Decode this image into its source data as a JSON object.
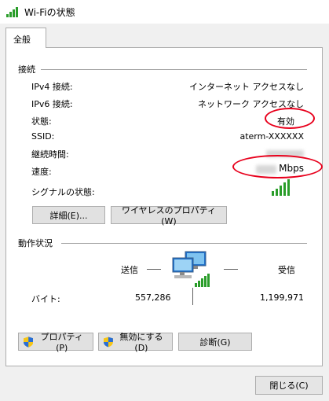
{
  "window": {
    "title": "Wi-Fiの状態",
    "icon": "wifi-signal-icon"
  },
  "tabs": [
    {
      "label": "全般"
    }
  ],
  "connection": {
    "heading": "接続",
    "rows": [
      {
        "label": "IPv4 接続:",
        "value": "インターネット アクセスなし"
      },
      {
        "label": "IPv6 接続:",
        "value": "ネットワーク アクセスなし"
      },
      {
        "label": "状態:",
        "value": "有効"
      },
      {
        "label": "SSID:",
        "value": "aterm-XXXXXX"
      },
      {
        "label": "継続時間:",
        "value": ""
      },
      {
        "label": "速度:",
        "value": "Mbps"
      }
    ],
    "signal_label": "シグナルの状態:",
    "signal_level": 1.0,
    "details_button": "詳細(E)...",
    "wireless_props_button": "ワイヤレスのプロパティ(W)"
  },
  "activity": {
    "heading": "動作状況",
    "sent_label": "送信",
    "received_label": "受信",
    "bytes_label": "バイト:",
    "bytes_sent": "557,286",
    "bytes_received": "1,199,971"
  },
  "buttons": {
    "properties": "プロパティ(P)",
    "disable": "無効にする(D)",
    "diagnose": "診断(G)",
    "close": "閉じる(C)"
  },
  "colors": {
    "highlight_oval": "#e8001c",
    "signal_green": "#2a9d2a"
  }
}
